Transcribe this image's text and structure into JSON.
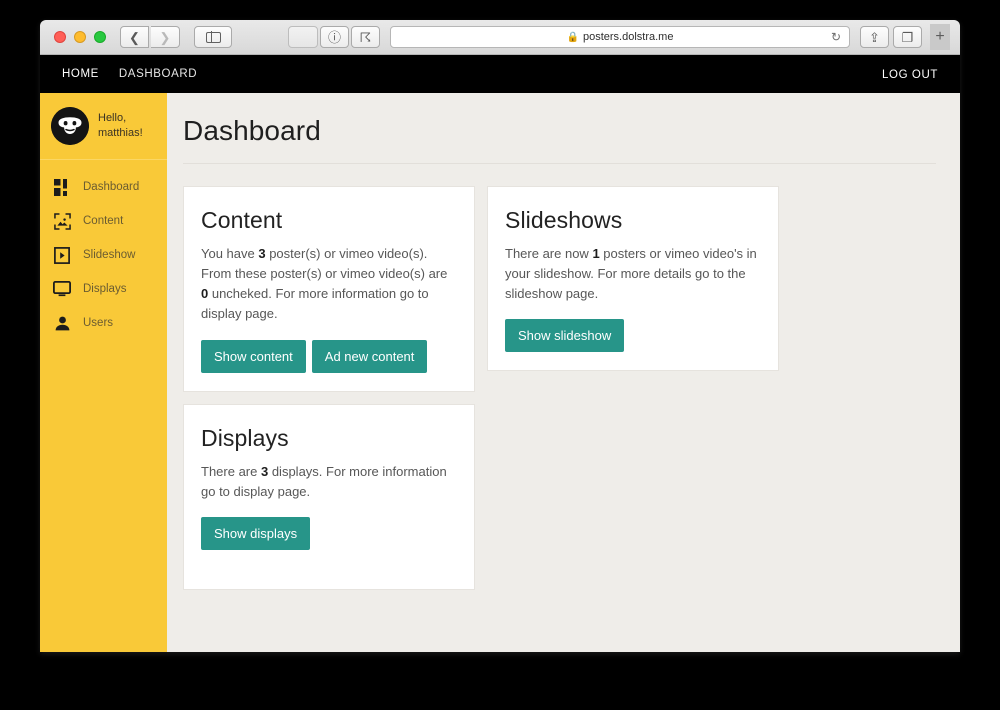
{
  "browser": {
    "url": "posters.dolstra.me",
    "lock_icon": "lock-icon",
    "reload_icon": "reload-icon",
    "back_icon": "chevron-left-icon",
    "forward_icon": "chevron-right-icon",
    "sidebar_icon": "sidebar-toggle-icon",
    "reader_icon": "reader-view-icon",
    "privacy_icon": "privacy-report-icon",
    "share_icon": "share-icon",
    "tabs_icon": "tab-overview-icon",
    "new_tab_icon": "plus-icon"
  },
  "topnav": {
    "home": "HOME",
    "dashboard": "DASHBOARD",
    "logout": "LOG OUT"
  },
  "sidebar": {
    "greeting_line1": "Hello,",
    "greeting_line2": "matthias!",
    "avatar_icon": "user-avatar-icon",
    "items": [
      {
        "label": "Dashboard",
        "icon": "dashboard-grid-icon"
      },
      {
        "label": "Content",
        "icon": "image-content-icon"
      },
      {
        "label": "Slideshow",
        "icon": "play-box-icon"
      },
      {
        "label": "Displays",
        "icon": "monitor-icon"
      },
      {
        "label": "Users",
        "icon": "person-icon"
      }
    ]
  },
  "main": {
    "title": "Dashboard",
    "cards": [
      {
        "title": "Content",
        "text_parts": [
          "You have ",
          "3",
          " poster(s) or vimeo video(s). From these poster(s) or vimeo video(s) are ",
          "0",
          " uncheked. For more information go to display page."
        ],
        "text_plain": "You have 3 poster(s) or vimeo video(s). From these poster(s) or vimeo video(s) are 0 uncheked. For more information go to display page.",
        "count_posters": "3",
        "count_unchecked": "0",
        "buttons": [
          "Show content",
          "Ad new content"
        ]
      },
      {
        "title": "Slideshows",
        "text_plain": "There are now 1 posters or vimeo video's in your slideshow. For more details go to the slideshow page.",
        "count_posters": "1",
        "buttons": [
          "Show slideshow"
        ]
      },
      {
        "title": "Displays",
        "text_plain": "There are 3 displays. For more information go to display page.",
        "count_displays": "3",
        "buttons": [
          "Show displays"
        ]
      }
    ]
  },
  "colors": {
    "sidebar_yellow": "#f9c938",
    "accent_teal": "#279589",
    "page_background": "#efede9",
    "topnav_black": "#000000",
    "card_white": "#ffffff"
  }
}
